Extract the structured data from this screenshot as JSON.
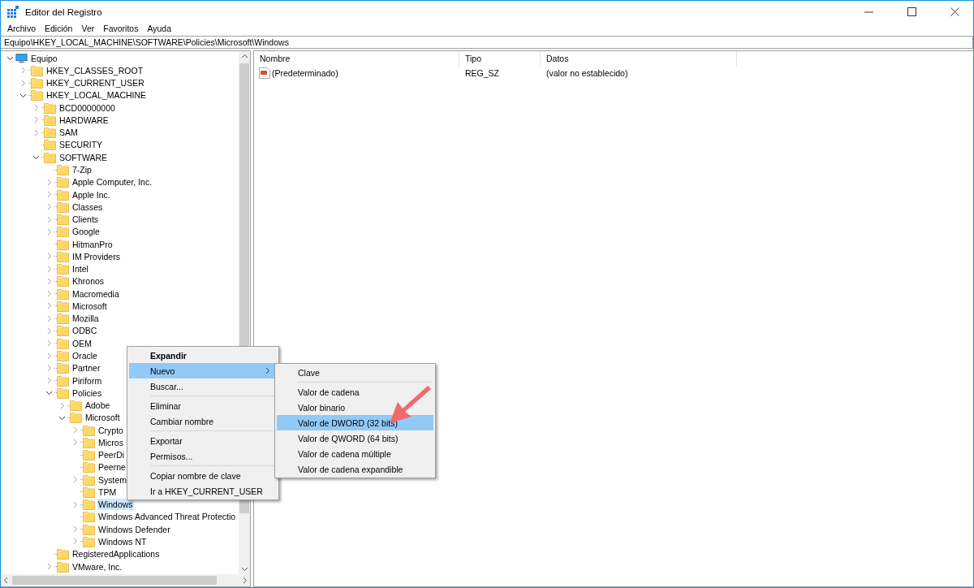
{
  "window": {
    "title": "Editor del Registro"
  },
  "menu_bar": [
    "Archivo",
    "Edición",
    "Ver",
    "Favoritos",
    "Ayuda"
  ],
  "address_bar": {
    "value": "Equipo\\HKEY_LOCAL_MACHINE\\SOFTWARE\\Policies\\Microsoft\\Windows"
  },
  "tree": [
    {
      "label": "Equipo",
      "kind": "computer",
      "expanded": true,
      "selected": false,
      "children": [
        {
          "label": "HKEY_CLASSES_ROOT",
          "kind": "branch",
          "expanded": false,
          "selected": false
        },
        {
          "label": "HKEY_CURRENT_USER",
          "kind": "branch",
          "expanded": false,
          "selected": false
        },
        {
          "label": "HKEY_LOCAL_MACHINE",
          "kind": "branch",
          "expanded": true,
          "selected": false,
          "children": [
            {
              "label": "BCD00000000",
              "kind": "branch",
              "expanded": false,
              "selected": false
            },
            {
              "label": "HARDWARE",
              "kind": "branch",
              "expanded": false,
              "selected": false
            },
            {
              "label": "SAM",
              "kind": "branch",
              "expanded": false,
              "selected": false
            },
            {
              "label": "SECURITY",
              "kind": "leaf",
              "selected": false
            },
            {
              "label": "SOFTWARE",
              "kind": "branch",
              "expanded": true,
              "selected": false,
              "children": [
                {
                  "label": "7-Zip",
                  "kind": "leaf",
                  "selected": false
                },
                {
                  "label": "Apple Computer, Inc.",
                  "kind": "branch",
                  "expanded": false,
                  "selected": false
                },
                {
                  "label": "Apple Inc.",
                  "kind": "branch",
                  "expanded": false,
                  "selected": false
                },
                {
                  "label": "Classes",
                  "kind": "branch",
                  "expanded": false,
                  "selected": false
                },
                {
                  "label": "Clients",
                  "kind": "branch",
                  "expanded": false,
                  "selected": false
                },
                {
                  "label": "Google",
                  "kind": "branch",
                  "expanded": false,
                  "selected": false
                },
                {
                  "label": "HitmanPro",
                  "kind": "leaf",
                  "selected": false
                },
                {
                  "label": "IM Providers",
                  "kind": "branch",
                  "expanded": false,
                  "selected": false
                },
                {
                  "label": "Intel",
                  "kind": "branch",
                  "expanded": false,
                  "selected": false
                },
                {
                  "label": "Khronos",
                  "kind": "branch",
                  "expanded": false,
                  "selected": false
                },
                {
                  "label": "Macromedia",
                  "kind": "branch",
                  "expanded": false,
                  "selected": false
                },
                {
                  "label": "Microsoft",
                  "kind": "branch",
                  "expanded": false,
                  "selected": false
                },
                {
                  "label": "Mozilla",
                  "kind": "branch",
                  "expanded": false,
                  "selected": false
                },
                {
                  "label": "ODBC",
                  "kind": "branch",
                  "expanded": false,
                  "selected": false
                },
                {
                  "label": "OEM",
                  "kind": "branch",
                  "expanded": false,
                  "selected": false
                },
                {
                  "label": "Oracle",
                  "kind": "branch",
                  "expanded": false,
                  "selected": false
                },
                {
                  "label": "Partner",
                  "kind": "branch",
                  "expanded": false,
                  "selected": false
                },
                {
                  "label": "Piriform",
                  "kind": "branch",
                  "expanded": false,
                  "selected": false
                },
                {
                  "label": "Policies",
                  "kind": "branch",
                  "expanded": true,
                  "selected": false,
                  "children": [
                    {
                      "label": "Adobe",
                      "kind": "branch",
                      "expanded": false,
                      "selected": false
                    },
                    {
                      "label": "Microsoft",
                      "kind": "branch",
                      "expanded": true,
                      "selected": false,
                      "children": [
                        {
                          "label": "Crypto",
                          "kind": "branch",
                          "expanded": false,
                          "selected": false
                        },
                        {
                          "label": "Micros",
                          "kind": "branch",
                          "expanded": false,
                          "selected": false
                        },
                        {
                          "label": "PeerDi",
                          "kind": "leaf",
                          "selected": false
                        },
                        {
                          "label": "Peerne",
                          "kind": "leaf",
                          "selected": false
                        },
                        {
                          "label": "System",
                          "kind": "branch",
                          "expanded": false,
                          "selected": false
                        },
                        {
                          "label": "TPM",
                          "kind": "leaf",
                          "selected": false
                        },
                        {
                          "label": "Windows",
                          "kind": "branch",
                          "expanded": false,
                          "selected": true
                        },
                        {
                          "label": "Windows Advanced Threat Protectio",
                          "kind": "leaf",
                          "selected": false
                        },
                        {
                          "label": "Windows Defender",
                          "kind": "branch",
                          "expanded": false,
                          "selected": false
                        },
                        {
                          "label": "Windows NT",
                          "kind": "branch",
                          "expanded": false,
                          "selected": false
                        }
                      ]
                    }
                  ]
                },
                {
                  "label": "RegisteredApplications",
                  "kind": "leaf",
                  "selected": false
                },
                {
                  "label": "VMware, Inc.",
                  "kind": "branch",
                  "expanded": false,
                  "selected": false
                }
              ]
            }
          ]
        }
      ]
    }
  ],
  "table": {
    "columns": [
      "Nombre",
      "Tipo",
      "Datos"
    ],
    "rows": [
      {
        "name": "(Predeterminado)",
        "type": "REG_SZ",
        "data": "(valor no establecido)"
      }
    ]
  },
  "context_menu": [
    {
      "kind": "item",
      "label": "Expandir",
      "default": true,
      "submenu": false,
      "selected": false
    },
    {
      "kind": "item",
      "label": "Nuevo",
      "default": false,
      "submenu": true,
      "selected": true
    },
    {
      "kind": "item",
      "label": "Buscar...",
      "default": false,
      "submenu": false,
      "selected": false
    },
    {
      "kind": "separator"
    },
    {
      "kind": "item",
      "label": "Eliminar",
      "default": false,
      "submenu": false,
      "selected": false
    },
    {
      "kind": "item",
      "label": "Cambiar nombre",
      "default": false,
      "submenu": false,
      "selected": false
    },
    {
      "kind": "separator"
    },
    {
      "kind": "item",
      "label": "Exportar",
      "default": false,
      "submenu": false,
      "selected": false
    },
    {
      "kind": "item",
      "label": "Permisos...",
      "default": false,
      "submenu": false,
      "selected": false
    },
    {
      "kind": "separator"
    },
    {
      "kind": "item",
      "label": "Copiar nombre de clave",
      "default": false,
      "submenu": false,
      "selected": false
    },
    {
      "kind": "item",
      "label": "Ir a HKEY_CURRENT_USER",
      "default": false,
      "submenu": false,
      "selected": false
    }
  ],
  "submenu": [
    {
      "kind": "item",
      "label": "Clave",
      "selected": false
    },
    {
      "kind": "separator"
    },
    {
      "kind": "item",
      "label": "Valor de cadena",
      "selected": false
    },
    {
      "kind": "item",
      "label": "Valor binario",
      "selected": false
    },
    {
      "kind": "item",
      "label": "Valor de DWORD (32 bits)",
      "selected": true
    },
    {
      "kind": "item",
      "label": "Valor de QWORD (64 bits)",
      "selected": false
    },
    {
      "kind": "item",
      "label": "Valor de cadena múltiple",
      "selected": false
    },
    {
      "kind": "item",
      "label": "Valor de cadena expandible",
      "selected": false
    }
  ]
}
